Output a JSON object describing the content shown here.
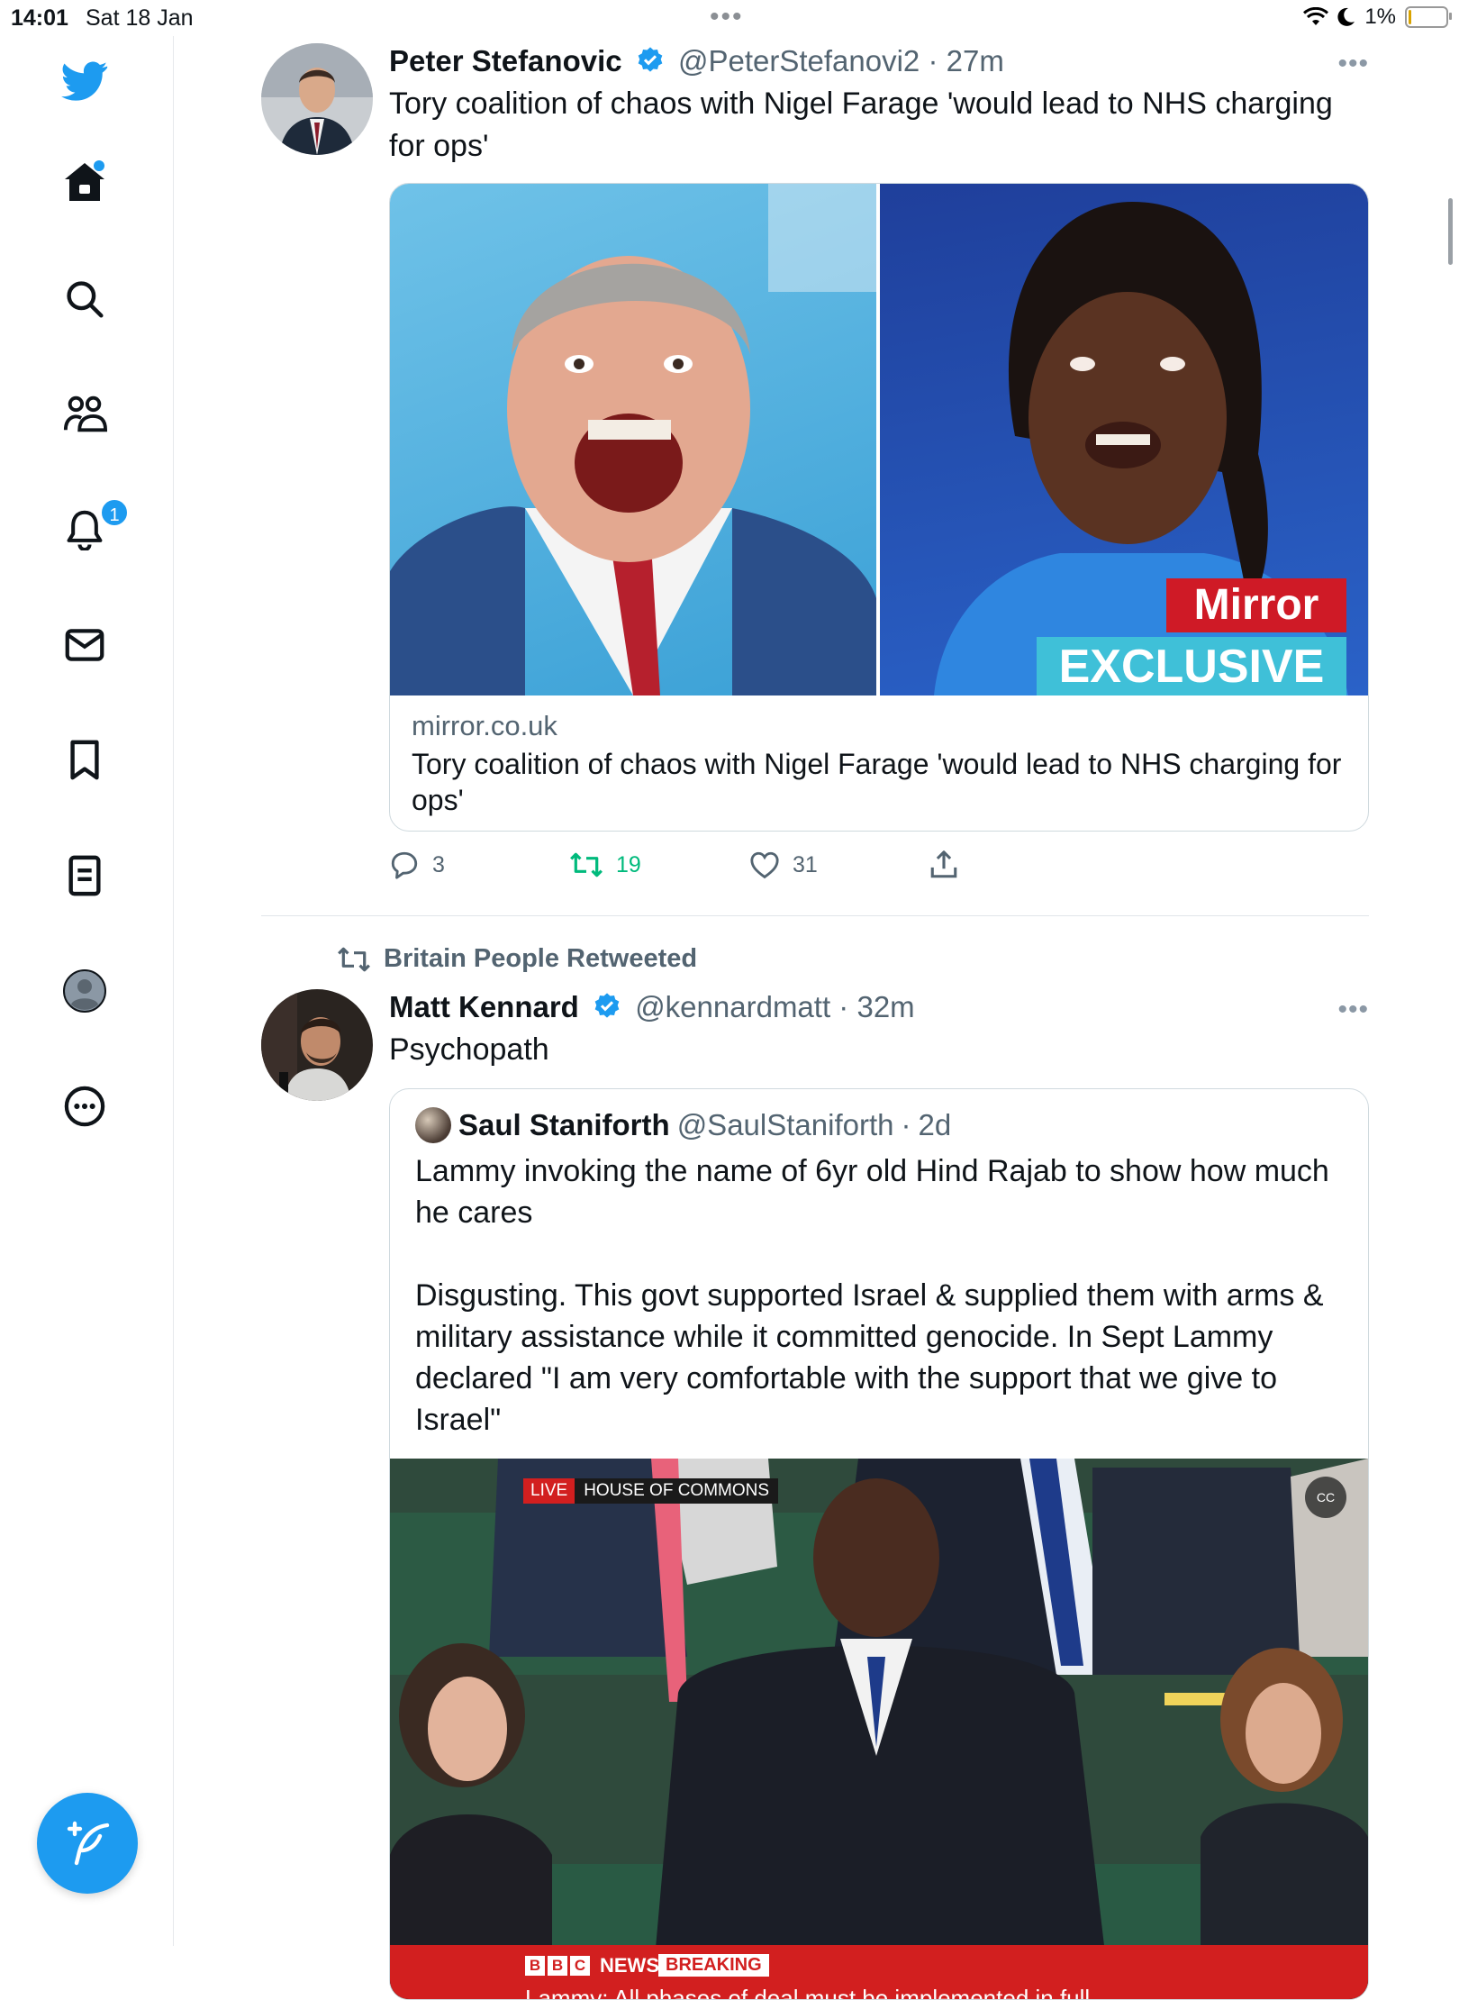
{
  "status_bar": {
    "time": "14:01",
    "date": "Sat 18 Jan",
    "battery": "1%"
  },
  "sidebar": {
    "notifications_badge": "1",
    "items": [
      {
        "icon": "twitter-bird-icon"
      },
      {
        "icon": "home-icon"
      },
      {
        "icon": "search-icon"
      },
      {
        "icon": "communities-icon"
      },
      {
        "icon": "notifications-icon"
      },
      {
        "icon": "messages-icon"
      },
      {
        "icon": "bookmarks-icon"
      },
      {
        "icon": "lists-icon"
      },
      {
        "icon": "profile-icon"
      },
      {
        "icon": "more-icon"
      }
    ],
    "compose_icon": "compose-tweet-icon"
  },
  "tweet1": {
    "name": "Peter Stefanovic",
    "handle": "@PeterStefanovi2",
    "time": "27m",
    "text": "Tory coalition of chaos with Nigel Farage 'would lead to NHS charging for ops'",
    "card": {
      "domain": "mirror.co.uk",
      "title": "Tory coalition of chaos with Nigel Farage 'would lead to NHS charging for ops'",
      "logo_mirror": "Mirror",
      "logo_exclusive": "EXCLUSIVE"
    },
    "replies": "3",
    "retweets": "19",
    "likes": "31"
  },
  "tweet2": {
    "social_context": "Britain People Retweeted",
    "name": "Matt Kennard",
    "handle": "@kennardmatt",
    "time": "32m",
    "text": "Psychopath",
    "quote": {
      "name": "Saul Staniforth",
      "handle": "@SaulStaniforth",
      "time": "2d",
      "paragraph1": "Lammy invoking the name of 6yr old Hind Rajab to show how much he cares",
      "paragraph2": "Disgusting. This govt supported Israel & supplied them with arms & military assistance while it committed genocide. In Sept Lammy declared \"I am very comfortable with the support that we give to Israel\"",
      "video": {
        "live": "LIVE",
        "channel": "HOUSE OF COMMONS",
        "cc": "CC",
        "bbc_news": "NEWS",
        "breaking": "BREAKING",
        "ticker": "Lammy: All phases of deal must be implemented in full"
      }
    }
  },
  "colors": {
    "accent": "#1d9bf0",
    "retweet": "#00ba7c",
    "muted": "#536471",
    "breaking_red": "#d21f1f"
  }
}
